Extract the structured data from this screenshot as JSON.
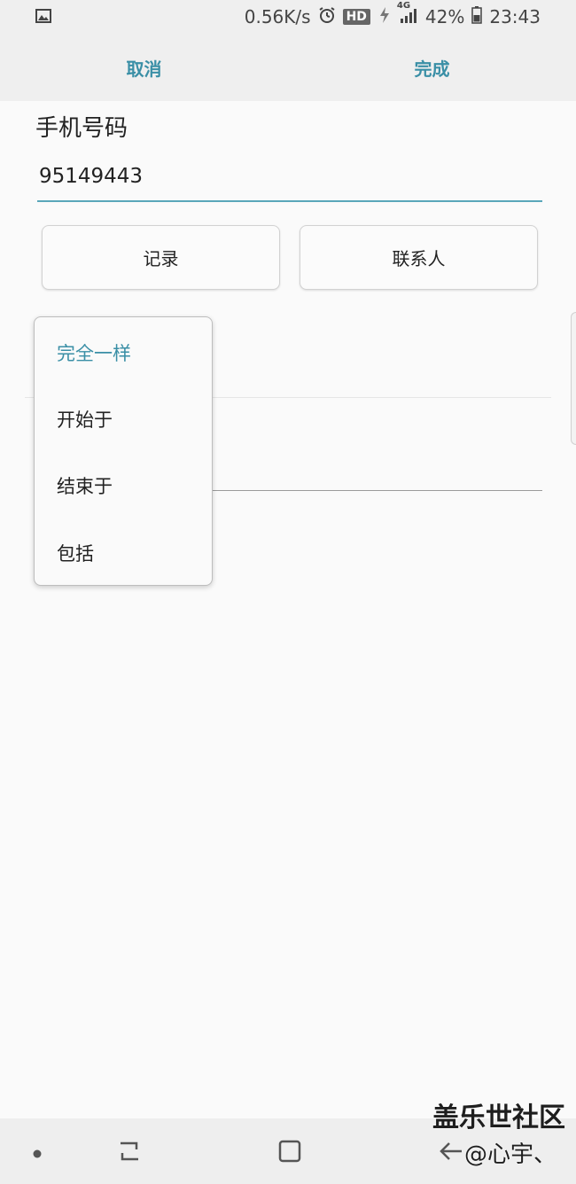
{
  "status_bar": {
    "network_speed": "0.56K/s",
    "hd_label": "HD",
    "network_type": "4G",
    "battery": "42%",
    "time": "23:43",
    "icons": [
      "image-icon",
      "alarm-icon",
      "hd-badge",
      "data-saver-icon",
      "signal-icon",
      "battery-icon"
    ]
  },
  "action_bar": {
    "cancel_label": "取消",
    "done_label": "完成"
  },
  "form": {
    "field_label": "手机号码",
    "phone_value": "95149443",
    "records_button": "记录",
    "contacts_button": "联系人"
  },
  "dropdown": {
    "items": [
      "完全一样",
      "开始于",
      "结束于",
      "包括"
    ],
    "selected_index": 0
  },
  "watermark": {
    "line1": "盖乐世社区",
    "line2": "@心宇、"
  },
  "nav_bar": {
    "icons": [
      "dot-icon",
      "recent-apps-icon",
      "home-icon",
      "back-icon"
    ]
  },
  "colors": {
    "accent": "#3a8fa6",
    "background": "#fafafa",
    "bar": "#efefef"
  }
}
